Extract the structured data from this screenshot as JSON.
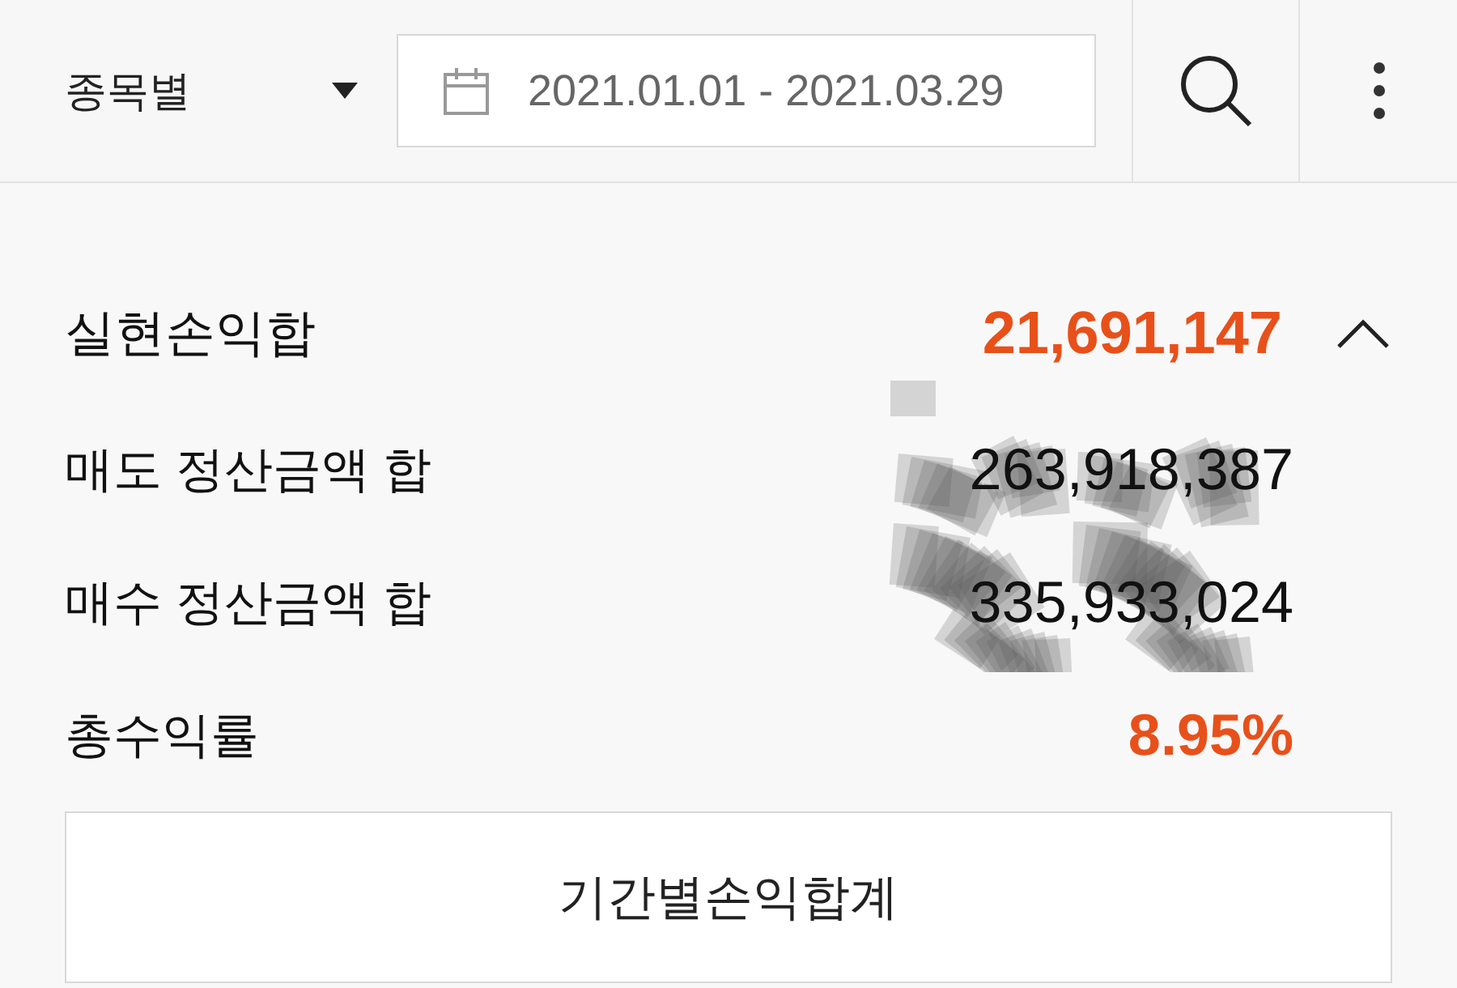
{
  "filter": {
    "label": "종목별"
  },
  "date_range": {
    "value": "2021.01.01 - 2021.03.29"
  },
  "summary": {
    "title": "실현손익합",
    "value": "21,691,147",
    "expanded": true
  },
  "rows": [
    {
      "label": "매도 정산금액 합",
      "value": "263,918,387",
      "kind": "plain"
    },
    {
      "label": "매수 정산금액 합",
      "value": "335,933,024",
      "kind": "plain"
    },
    {
      "label": "총수익률",
      "value": "8.95%",
      "kind": "highlight"
    }
  ],
  "button": {
    "label": "기간별손익합계"
  }
}
